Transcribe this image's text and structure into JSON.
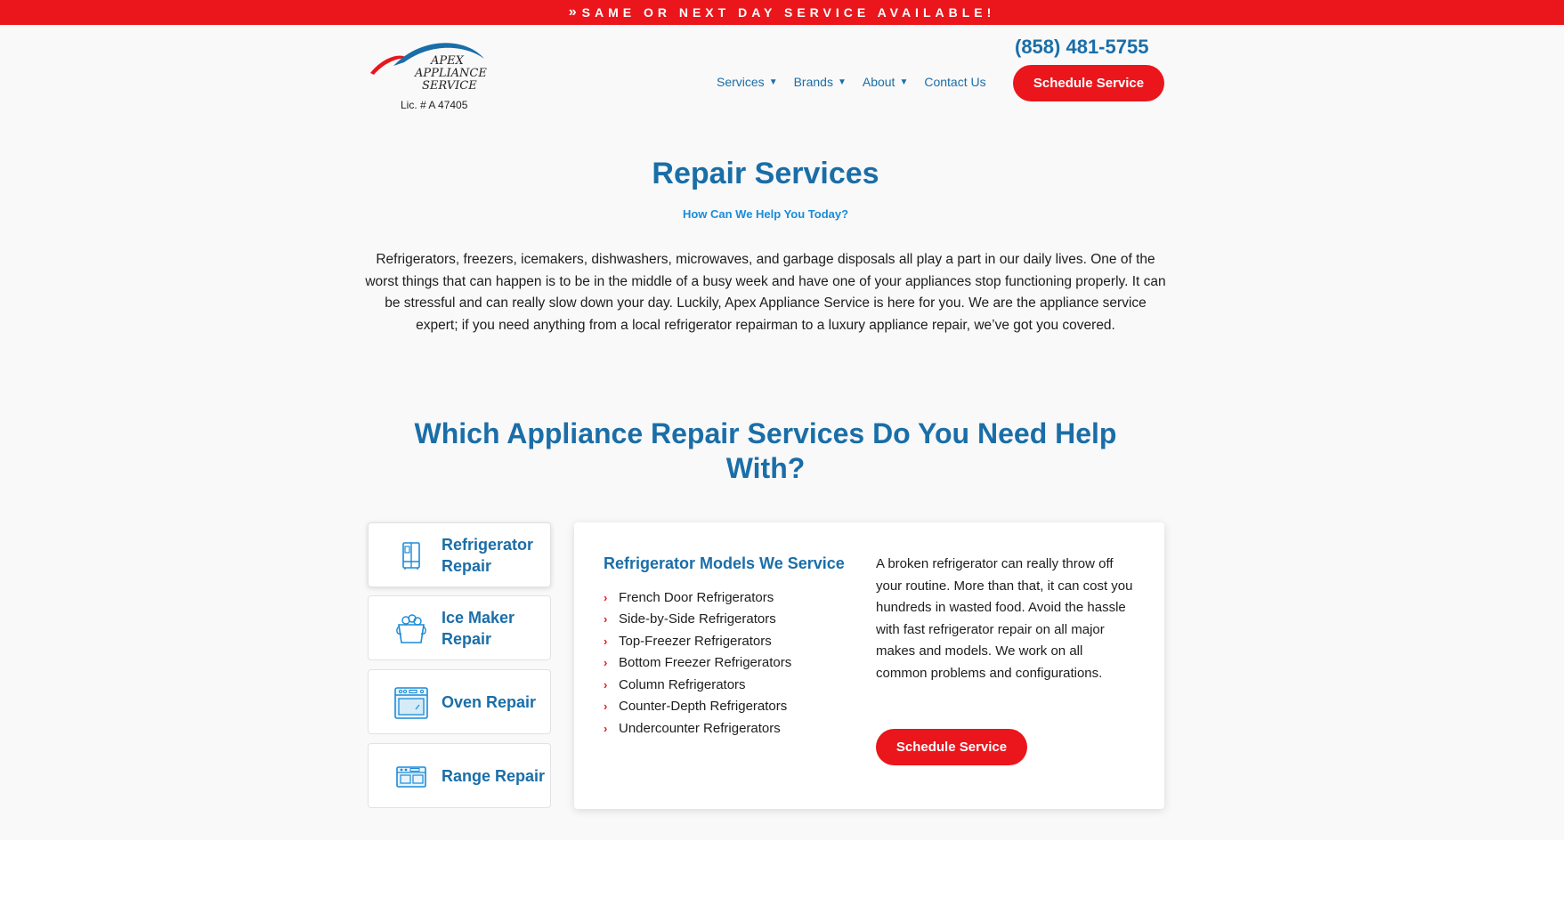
{
  "promo_bar": {
    "chevron": "»",
    "text": "SAME OR NEXT DAY SERVICE AVAILABLE!"
  },
  "header": {
    "logo_text": {
      "line1": "APEX",
      "line2": "APPLIANCE",
      "line3": "SERVICE"
    },
    "license": "Lic. # A 47405",
    "phone": "(858) 481-5755",
    "nav": [
      {
        "label": "Services",
        "has_dropdown": true
      },
      {
        "label": "Brands",
        "has_dropdown": true
      },
      {
        "label": "About",
        "has_dropdown": true
      },
      {
        "label": "Contact Us",
        "has_dropdown": false
      }
    ],
    "cta_label": "Schedule Service"
  },
  "intro": {
    "title": "Repair Services",
    "subtitle": "How Can We Help You Today?",
    "body": "Refrigerators, freezers, icemakers, dishwashers, microwaves, and garbage disposals all play a part in our daily lives. One of the worst things that can happen is to be in the middle of a busy week and have one of your appliances stop functioning properly. It can be stressful and can really slow down your day. Luckily, Apex Appliance Service is here for you. We are the appliance service expert; if you need anything from a local refrigerator repairman to a luxury appliance repair, we’ve got you covered."
  },
  "services": {
    "heading": "Which Appliance Repair Services Do You Need Help With?",
    "tabs": [
      {
        "label": "Refrigerator Repair",
        "icon": "refrigerator-icon",
        "active": true
      },
      {
        "label": "Ice Maker Repair",
        "icon": "ice-bucket-icon",
        "active": false
      },
      {
        "label": "Oven Repair",
        "icon": "oven-icon",
        "active": false
      },
      {
        "label": "Range Repair",
        "icon": "range-icon",
        "active": false
      }
    ],
    "panel": {
      "heading": "Refrigerator Models We Service",
      "bullet": "›",
      "models": [
        "French Door Refrigerators",
        "Side-by-Side Refrigerators",
        "Top-Freezer Refrigerators",
        "Bottom Freezer Refrigerators",
        "Column Refrigerators",
        "Counter-Depth Refrigerators",
        "Undercounter Refrigerators"
      ],
      "description": "A broken refrigerator can really throw off your routine. More than that, it can cost you hundreds in wasted food. Avoid the hassle with fast refrigerator repair on all major makes and models. We work on all common problems and configurations.",
      "cta_label": "Schedule Service"
    }
  },
  "colors": {
    "brand_red": "#ea161c",
    "brand_blue": "#1a6ea8",
    "light_blue": "#1a8cd8"
  }
}
